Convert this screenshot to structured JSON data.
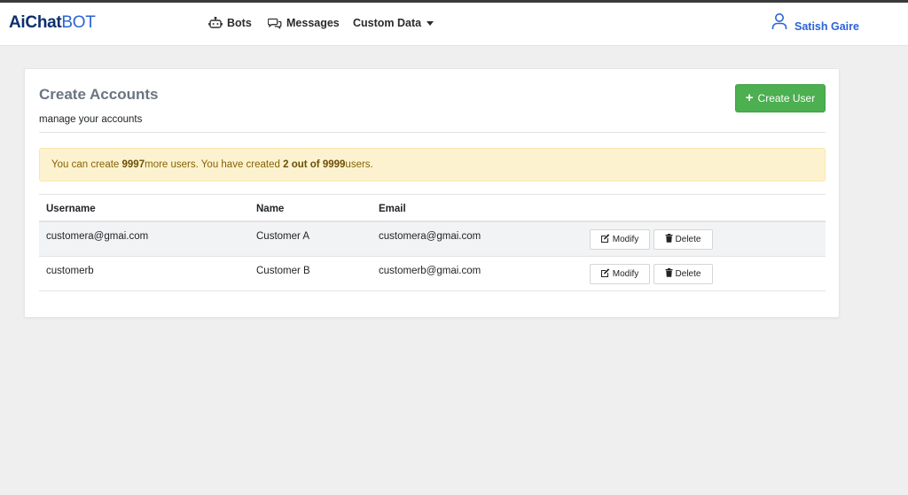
{
  "brand": {
    "part1": "AiChat",
    "part2": "BOT"
  },
  "nav": {
    "bots": "Bots",
    "messages": "Messages",
    "custom_data": "Custom Data"
  },
  "user": {
    "name": "Satish Gaire"
  },
  "page": {
    "title": "Create Accounts",
    "subtitle": "manage your accounts",
    "create_button": "Create User"
  },
  "alert": {
    "prefix": "You can create ",
    "remaining": "9997",
    "middle": " more users. You have created ",
    "created": "2 out of 9999",
    "suffix": " users."
  },
  "table": {
    "headers": {
      "username": "Username",
      "name": "Name",
      "email": "Email"
    },
    "rows": [
      {
        "username": "customera@gmai.com",
        "name": "Customer A",
        "email": "customera@gmai.com"
      },
      {
        "username": "customerb",
        "name": "Customer B",
        "email": "customerb@gmai.com"
      }
    ],
    "modify_label": "Modify",
    "delete_label": "Delete"
  },
  "colors": {
    "brand_dark": "#0d2e6e",
    "brand_accent": "#2d63d4",
    "success": "#4caf50",
    "alert_bg": "#fdf2cf",
    "alert_text": "#856404"
  }
}
